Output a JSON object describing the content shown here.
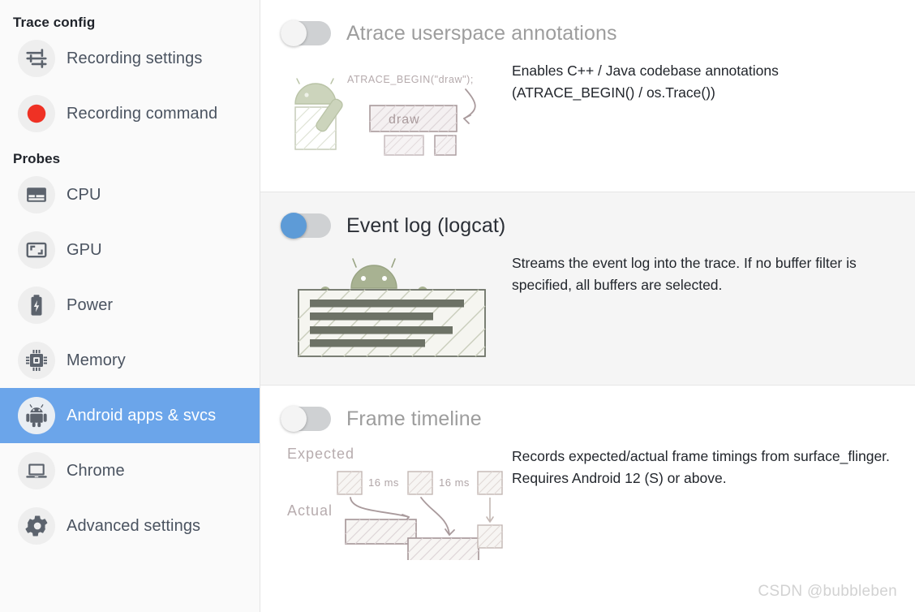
{
  "sidebar": {
    "sections": [
      {
        "title": "Trace config",
        "items": [
          {
            "label": "Recording settings",
            "icon": "tune-sliders-icon",
            "name": "sidebar-item-recording-settings",
            "selected": false
          },
          {
            "label": "Recording command",
            "icon": "record-circle-icon",
            "name": "sidebar-item-recording-command",
            "selected": false
          }
        ]
      },
      {
        "title": "Probes",
        "items": [
          {
            "label": "CPU",
            "icon": "cpu-chip-icon",
            "name": "sidebar-item-cpu",
            "selected": false
          },
          {
            "label": "GPU",
            "icon": "gpu-screen-icon",
            "name": "sidebar-item-gpu",
            "selected": false
          },
          {
            "label": "Power",
            "icon": "battery-bolt-icon",
            "name": "sidebar-item-power",
            "selected": false
          },
          {
            "label": "Memory",
            "icon": "memory-chip-icon",
            "name": "sidebar-item-memory",
            "selected": false
          },
          {
            "label": "Android apps & svcs",
            "icon": "android-robot-icon",
            "name": "sidebar-item-android-apps-svcs",
            "selected": true
          },
          {
            "label": "Chrome",
            "icon": "laptop-icon",
            "name": "sidebar-item-chrome",
            "selected": false
          },
          {
            "label": "Advanced settings",
            "icon": "gear-icon",
            "name": "sidebar-item-advanced-settings",
            "selected": false
          }
        ]
      }
    ]
  },
  "probes": [
    {
      "title": "Atrace userspace annotations",
      "enabled": false,
      "description": "Enables C++ / Java codebase annotations (ATRACE_BEGIN() / os.Trace())",
      "art": {
        "name": "atrace-sketch",
        "code_label": "ATRACE_BEGIN(\"draw\");",
        "slice_label": "draw"
      }
    },
    {
      "title": "Event log (logcat)",
      "enabled": true,
      "description": "Streams the event log into the trace. If no buffer filter is specified, all buffers are selected.",
      "art": {
        "name": "logcat-sketch"
      }
    },
    {
      "title": "Frame timeline",
      "enabled": false,
      "description": "Records expected/actual frame timings from surface_flinger. Requires Android 12 (S) or above.",
      "art": {
        "name": "frame-timeline-sketch",
        "row_expected": "Expected",
        "row_actual": "Actual",
        "gap_label_1": "16 ms",
        "gap_label_2": "16 ms"
      }
    }
  ],
  "watermark": "CSDN @bubbleben",
  "colors": {
    "accent_blue": "#6ba5ea",
    "toggle_on_blue": "#5d9bd7",
    "record_red": "#ef3124",
    "sidebar_bg": "#fafafa",
    "enabled_card_bg": "#f5f5f5",
    "sketch_green": "#a8b292",
    "sketch_mauve": "#a99a9c"
  }
}
